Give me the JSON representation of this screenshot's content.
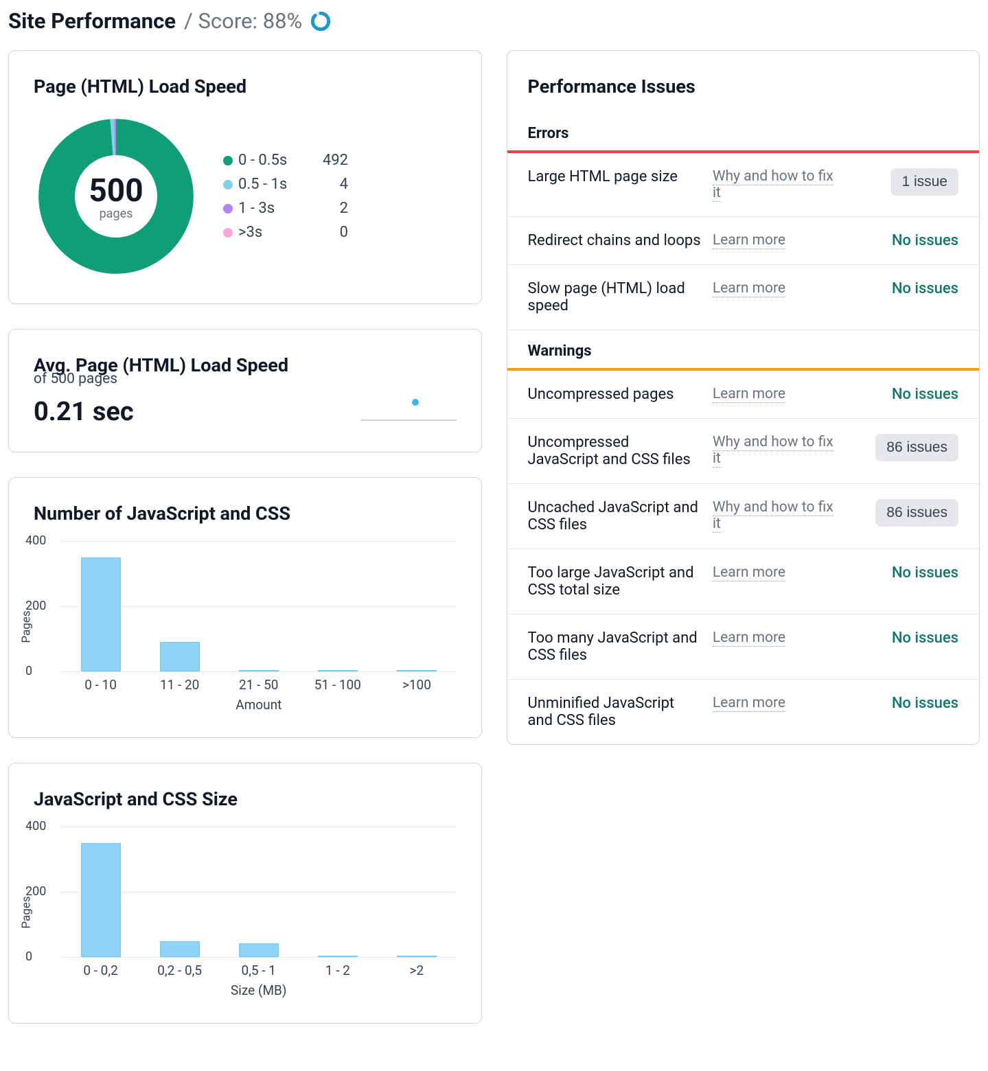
{
  "header": {
    "title": "Site Performance",
    "score_label": "/ Score: 88%"
  },
  "chart_data": [
    {
      "type": "pie",
      "title": "Page (HTML) Load Speed",
      "center_value": "500",
      "center_label": "pages",
      "series": [
        {
          "name": "0 - 0.5s",
          "value": 492,
          "color": "#0f9d7a"
        },
        {
          "name": "0.5 - 1s",
          "value": 4,
          "color": "#7ed1e6"
        },
        {
          "name": "1 - 3s",
          "value": 2,
          "color": "#b084f5"
        },
        {
          "name": ">3s",
          "value": 0,
          "color": "#f7a8d8"
        }
      ]
    },
    {
      "type": "bar",
      "title": "Number of JavaScript and CSS",
      "xlabel": "Amount",
      "ylabel": "Pages",
      "yticks": [
        0,
        200,
        400
      ],
      "ylim": [
        0,
        400
      ],
      "categories": [
        "0 - 10",
        "11 - 20",
        "21 - 50",
        "51 - 100",
        ">100"
      ],
      "values": [
        350,
        90,
        0,
        0,
        0
      ]
    },
    {
      "type": "bar",
      "title": "JavaScript and CSS Size",
      "xlabel": "Size (MB)",
      "ylabel": "Pages",
      "yticks": [
        0,
        200,
        400
      ],
      "ylim": [
        0,
        400
      ],
      "categories": [
        "0 - 0,2",
        "0,2 - 0,5",
        "0,5 - 1",
        "1 - 2",
        ">2"
      ],
      "values": [
        350,
        48,
        42,
        0,
        0
      ]
    }
  ],
  "avg_speed": {
    "title": "Avg. Page (HTML) Load Speed",
    "subtitle": "of 500 pages",
    "value": "0.21 sec"
  },
  "issues": {
    "title": "Performance Issues",
    "sections": [
      {
        "heading": "Errors",
        "accent": "red",
        "items": [
          {
            "name": "Large HTML page size",
            "link": "Why and how to fix it",
            "status_type": "count",
            "status": "1 issue"
          },
          {
            "name": "Redirect chains and loops",
            "link": "Learn more",
            "status_type": "ok",
            "status": "No issues"
          },
          {
            "name": "Slow page (HTML) load speed",
            "link": "Learn more",
            "status_type": "ok",
            "status": "No issues"
          }
        ]
      },
      {
        "heading": "Warnings",
        "accent": "orange",
        "items": [
          {
            "name": "Uncompressed pages",
            "link": "Learn more",
            "status_type": "ok",
            "status": "No issues"
          },
          {
            "name": "Uncompressed JavaScript and CSS files",
            "link": "Why and how to fix it",
            "status_type": "count",
            "status": "86 issues"
          },
          {
            "name": "Uncached JavaScript and CSS files",
            "link": "Why and how to fix it",
            "status_type": "count",
            "status": "86 issues"
          },
          {
            "name": "Too large JavaScript and CSS total size",
            "link": "Learn more",
            "status_type": "ok",
            "status": "No issues"
          },
          {
            "name": "Too many JavaScript and CSS files",
            "link": "Learn more",
            "status_type": "ok",
            "status": "No issues"
          },
          {
            "name": "Unminified JavaScript and CSS files",
            "link": "Learn more",
            "status_type": "ok",
            "status": "No issues"
          }
        ]
      }
    ]
  }
}
